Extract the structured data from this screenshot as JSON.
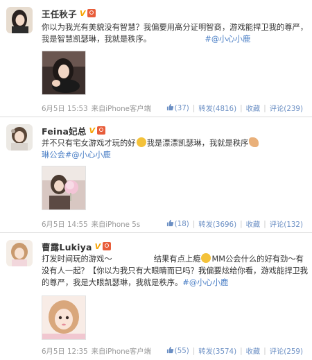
{
  "colors": {
    "link": "#4b7fc6",
    "text": "#333333",
    "meta": "#999999",
    "badge": "#f6a300"
  },
  "posts": [
    {
      "username": "王任秋子",
      "badge": "V",
      "text": "你以为我光有美貌没有智慧？我偏要用高分证明智商，游戏能捍卫我的尊严，我是智慧凯瑟琳，我就是秩序。",
      "tag": "#@小心小鹿",
      "time": "6月5日 15:53",
      "source": "来自iPhone客户端",
      "like": "(37)",
      "repost": "转发(4816)",
      "fav": "收藏",
      "comment": "评论(239)"
    },
    {
      "username": "Feina妃总",
      "badge": "V",
      "text_a": "并不只有宅女游戏才玩的好",
      "text_b": "我是漂漂凯瑟琳，我就是秩序",
      "text_c": "琳公会",
      "tag": "#@小心小鹿",
      "time": "6月5日 14:55",
      "source": "来自iPhone 5s",
      "like": "(18)",
      "repost": "转发(3696)",
      "fav": "收藏",
      "comment": "评论(132)"
    },
    {
      "username": "曹露Lukiya",
      "badge": "V",
      "text_a": "打发时间玩的游戏～",
      "text_b": "结果有点上瘾",
      "text_c": "MM公会什么的好有劲～有没有人一起？【你以为我只有大眼睛而已吗？我偏要炫给你看，游戏能捍卫我的尊严，我是大眼凯瑟琳，我就是秩序。",
      "tag": "#@小心小鹿",
      "time": "6月5日 12:35",
      "source": "来自iPhone客户端",
      "like": "(55)",
      "repost": "转发(3574)",
      "fav": "收藏",
      "comment": "评论(259)"
    }
  ]
}
